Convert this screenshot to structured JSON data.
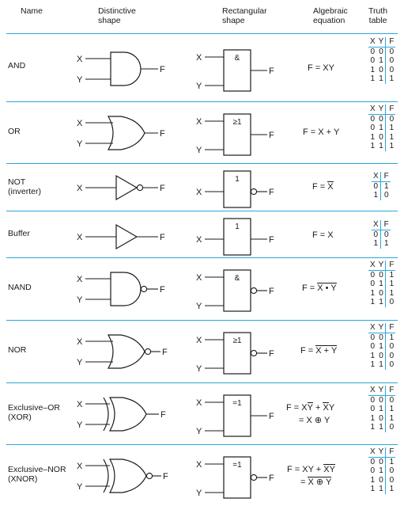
{
  "header": {
    "columns": [
      {
        "id": "name",
        "label": "Name"
      },
      {
        "id": "distinctive",
        "label": "Distinctive\nshape"
      },
      {
        "id": "rectangular",
        "label": "Rectangular\nshape"
      },
      {
        "id": "algebraic",
        "label": "Algebraic\nequation"
      },
      {
        "id": "truth",
        "label": "Truth\ntable"
      }
    ]
  },
  "colors": {
    "rule": "#29a8df",
    "divider": "#29a8df",
    "ink": "#1a1a1a",
    "background": "#ffffff"
  },
  "labels": {
    "input_x": "X",
    "input_y": "Y",
    "output_f": "F"
  },
  "rows": [
    {
      "id": "and",
      "name": "AND",
      "distinctive_shape": "and-gate-symbol",
      "rectangular_label": "&",
      "rect_bubble": false,
      "dist_bubble": false,
      "inputs": [
        "X",
        "Y"
      ],
      "output": "F",
      "equation_lines": [
        "F = XY"
      ],
      "truth": {
        "headers": [
          "X",
          "Y",
          "F"
        ],
        "rows": [
          [
            "0",
            "0",
            "0"
          ],
          [
            "0",
            "1",
            "0"
          ],
          [
            "1",
            "0",
            "0"
          ],
          [
            "1",
            "1",
            "1"
          ]
        ]
      }
    },
    {
      "id": "or",
      "name": "OR",
      "distinctive_shape": "or-gate-symbol",
      "rectangular_label": "≥1",
      "rect_bubble": false,
      "dist_bubble": false,
      "inputs": [
        "X",
        "Y"
      ],
      "output": "F",
      "equation_lines": [
        "F = X + Y"
      ],
      "truth": {
        "headers": [
          "X",
          "Y",
          "F"
        ],
        "rows": [
          [
            "0",
            "0",
            "0"
          ],
          [
            "0",
            "1",
            "1"
          ],
          [
            "1",
            "0",
            "1"
          ],
          [
            "1",
            "1",
            "1"
          ]
        ]
      }
    },
    {
      "id": "not",
      "name": "NOT\n(inverter)",
      "distinctive_shape": "not-gate-symbol",
      "rectangular_label": "1",
      "rect_bubble": true,
      "dist_bubble": true,
      "inputs": [
        "X"
      ],
      "output": "F",
      "equation_lines": [
        "F = X̅"
      ],
      "truth": {
        "headers": [
          "X",
          "F"
        ],
        "rows": [
          [
            "0",
            "1"
          ],
          [
            "1",
            "0"
          ]
        ]
      }
    },
    {
      "id": "buffer",
      "name": "Buffer",
      "distinctive_shape": "buffer-gate-symbol",
      "rectangular_label": "1",
      "rect_bubble": false,
      "dist_bubble": false,
      "inputs": [
        "X"
      ],
      "output": "F",
      "equation_lines": [
        "F = X"
      ],
      "truth": {
        "headers": [
          "X",
          "F"
        ],
        "rows": [
          [
            "0",
            "0"
          ],
          [
            "1",
            "1"
          ]
        ]
      }
    },
    {
      "id": "nand",
      "name": "NAND",
      "distinctive_shape": "nand-gate-symbol",
      "rectangular_label": "&",
      "rect_bubble": true,
      "dist_bubble": true,
      "inputs": [
        "X",
        "Y"
      ],
      "output": "F",
      "equation_lines": [
        "F = X • Y (overbar)"
      ],
      "truth": {
        "headers": [
          "X",
          "Y",
          "F"
        ],
        "rows": [
          [
            "0",
            "0",
            "1"
          ],
          [
            "0",
            "1",
            "1"
          ],
          [
            "1",
            "0",
            "1"
          ],
          [
            "1",
            "1",
            "0"
          ]
        ]
      }
    },
    {
      "id": "nor",
      "name": "NOR",
      "distinctive_shape": "nor-gate-symbol",
      "rectangular_label": "≥1",
      "rect_bubble": true,
      "dist_bubble": true,
      "inputs": [
        "X",
        "Y"
      ],
      "output": "F",
      "equation_lines": [
        "F = X + Y (overbar)"
      ],
      "truth": {
        "headers": [
          "X",
          "Y",
          "F"
        ],
        "rows": [
          [
            "0",
            "0",
            "1"
          ],
          [
            "0",
            "1",
            "0"
          ],
          [
            "1",
            "0",
            "0"
          ],
          [
            "1",
            "1",
            "0"
          ]
        ]
      }
    },
    {
      "id": "xor",
      "name": "Exclusive–OR\n(XOR)",
      "distinctive_shape": "xor-gate-symbol",
      "rectangular_label": "=1",
      "rect_bubble": false,
      "dist_bubble": false,
      "inputs": [
        "X",
        "Y"
      ],
      "output": "F",
      "equation_lines": [
        "F = XY̅ + X̅Y",
        "= X ⊕ Y"
      ],
      "truth": {
        "headers": [
          "X",
          "Y",
          "F"
        ],
        "rows": [
          [
            "0",
            "0",
            "0"
          ],
          [
            "0",
            "1",
            "1"
          ],
          [
            "1",
            "0",
            "1"
          ],
          [
            "1",
            "1",
            "0"
          ]
        ]
      }
    },
    {
      "id": "xnor",
      "name": "Exclusive–NOR\n(XNOR)",
      "distinctive_shape": "xnor-gate-symbol",
      "rectangular_label": "=1",
      "rect_bubble": true,
      "dist_bubble": true,
      "inputs": [
        "X",
        "Y"
      ],
      "output": "F",
      "equation_lines": [
        "F = XY + X̅Y̅",
        "= X ⊕ Y (overbar)"
      ],
      "truth": {
        "headers": [
          "X",
          "Y",
          "F"
        ],
        "rows": [
          [
            "0",
            "0",
            "1"
          ],
          [
            "0",
            "1",
            "0"
          ],
          [
            "1",
            "0",
            "0"
          ],
          [
            "1",
            "1",
            "1"
          ]
        ]
      }
    }
  ],
  "equation_parts": {
    "and": {
      "lhs": "F = ",
      "body": "XY"
    },
    "or": {
      "lhs": "F = ",
      "body": "X + Y"
    },
    "not": {
      "lhs": "F = ",
      "bar": "X"
    },
    "buffer": {
      "lhs": "F = ",
      "body": "X"
    },
    "nand": {
      "lhs": "F = ",
      "bar": "X • Y"
    },
    "nor": {
      "lhs": "F = ",
      "bar": "X + Y"
    },
    "xor": {
      "l1_lhs": "F = X",
      "l1_bar1": "Y",
      "l1_mid": " + ",
      "l1_bar2": "X",
      "l1_tail": "Y",
      "l2": "= X ⊕ Y"
    },
    "xnor": {
      "l1_lhs": "F = XY + ",
      "l1_bar": "XY",
      "l2_lhs": "= ",
      "l2_bar": "X ⊕ Y"
    }
  }
}
